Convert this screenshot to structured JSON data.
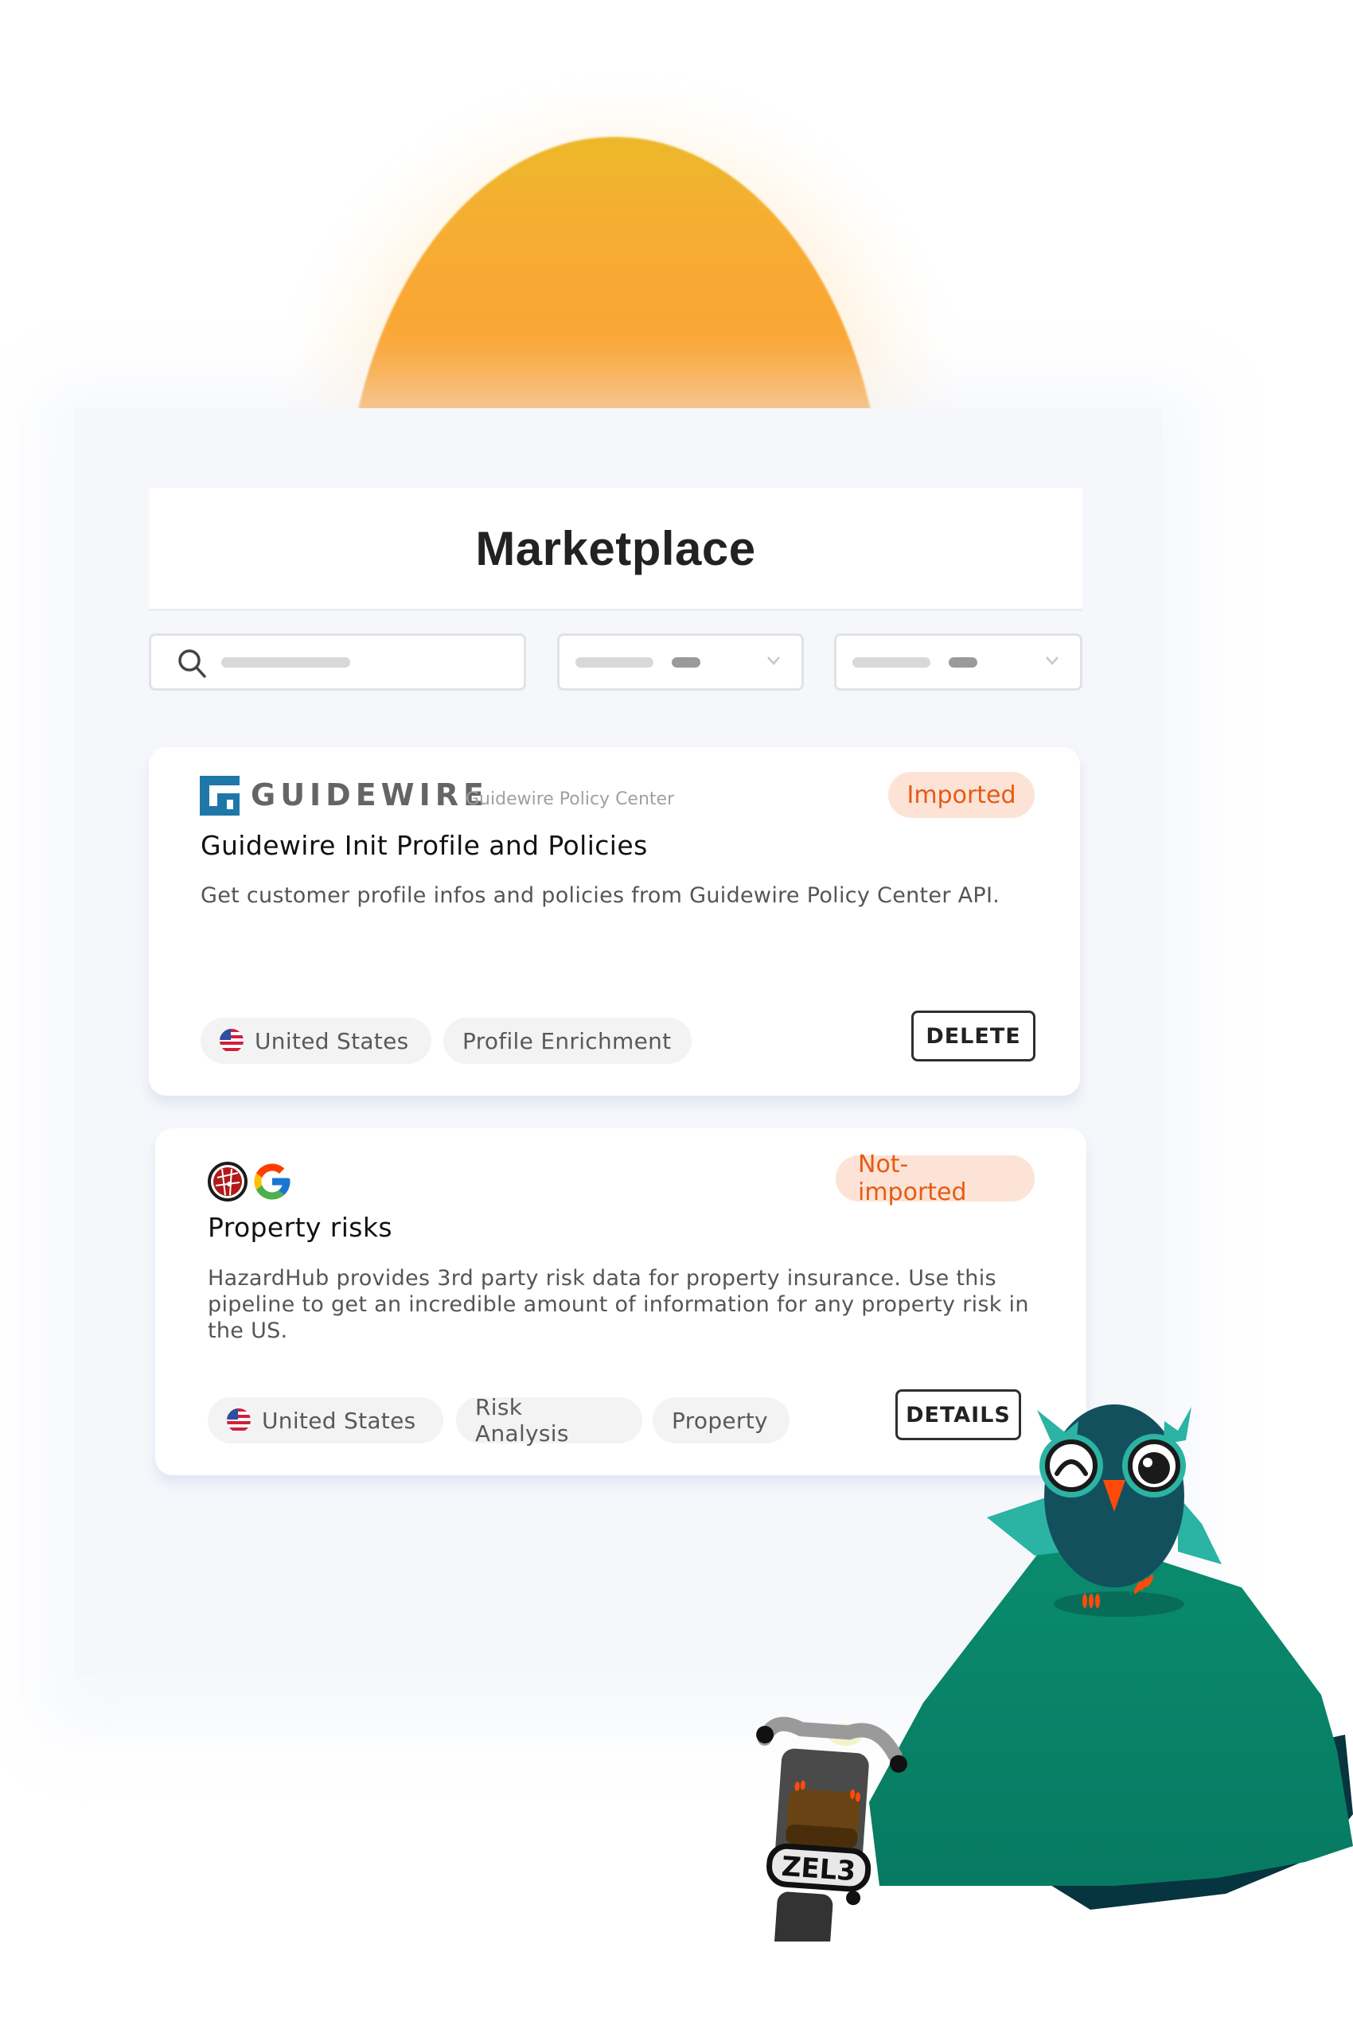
{
  "header": {
    "title": "Marketplace"
  },
  "filters": {
    "search_placeholder_icon": "search-icon",
    "dropdowns": [
      {
        "name": "filter-dropdown-1",
        "icon": "chevron-down-icon"
      },
      {
        "name": "filter-dropdown-2",
        "icon": "chevron-down-icon"
      }
    ]
  },
  "cards": [
    {
      "brand_name": "GUIDEWIRE",
      "brand_subtitle": "Guidewire Policy Center",
      "status": "Imported",
      "title": "Guidewire Init Profile and Policies",
      "description": "Get customer profile infos and policies from Guidewire Policy Center API.",
      "tags": [
        {
          "label": "United States",
          "icon": "us-flag-icon"
        },
        {
          "label": "Profile Enrichment"
        }
      ],
      "action_label": "DELETE"
    },
    {
      "provider_icons": [
        "hazardhub-icon",
        "google-icon"
      ],
      "status": "Not-imported",
      "title": "Property risks",
      "description": "HazardHub provides 3rd party risk data for property insurance. Use this pipeline to get an incredible amount of information for any property risk in the US.",
      "tags": [
        {
          "label": "United States",
          "icon": "us-flag-icon"
        },
        {
          "label": "Risk Analysis"
        },
        {
          "label": "Property"
        }
      ],
      "action_label": "DETAILS"
    }
  ],
  "illustration": {
    "license_plate": "ZEL3"
  },
  "colors": {
    "status_badge_bg": "#fde3d6",
    "status_badge_text": "#e55b14",
    "guidewire_blue": "#1f77a8",
    "panel_bg": "#f5f7fb",
    "rock_green": "#0a8a6c",
    "owl_teal": "#2bb3a3"
  }
}
